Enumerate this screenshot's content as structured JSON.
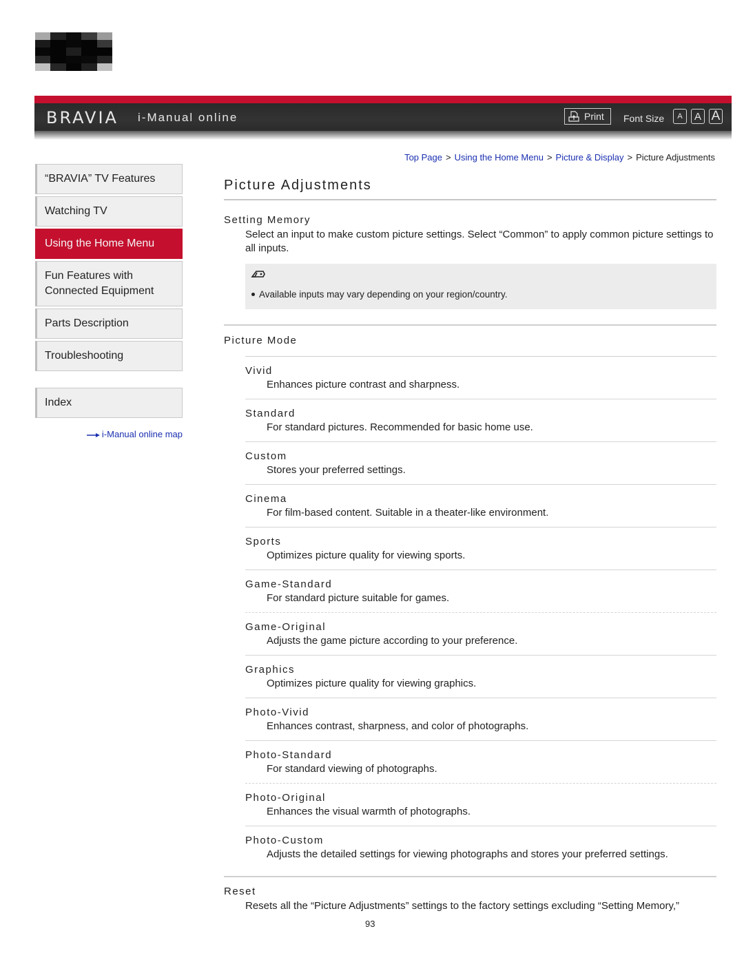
{
  "logo_pixels": [
    [
      "#a8a8a8",
      "#222222",
      "#0c0c0c",
      "#3c3c3c",
      "#9a9a9a"
    ],
    [
      "#1a1a1a",
      "#050505",
      "#080808",
      "#050505",
      "#383838"
    ],
    [
      "#080808",
      "#050505",
      "#1e1e1e",
      "#050505",
      "#050505"
    ],
    [
      "#2a2a2a",
      "#050505",
      "#080808",
      "#0a0a0a",
      "#262626"
    ],
    [
      "#c0c0c0",
      "#262626",
      "#050505",
      "#202020",
      "#c0c0c0"
    ]
  ],
  "header": {
    "brand": "BRAVIA",
    "subtitle": "i-Manual online",
    "print_label": "Print",
    "font_size_label": "Font Size",
    "font_size_options": [
      "A",
      "A",
      "A"
    ],
    "accent_color": "#c4102e"
  },
  "breadcrumb": {
    "items": [
      "Top Page",
      "Using the Home Menu",
      "Picture & Display"
    ],
    "current": "Picture Adjustments",
    "separator": ">"
  },
  "sidebar": {
    "items": [
      {
        "label": "“BRAVIA” TV Features",
        "active": false
      },
      {
        "label": "Watching TV",
        "active": false
      },
      {
        "label": "Using the Home Menu",
        "active": true
      },
      {
        "label": "Fun Features with Connected Equipment",
        "active": false
      },
      {
        "label": "Parts Description",
        "active": false
      },
      {
        "label": "Troubleshooting",
        "active": false
      }
    ],
    "index_label": "Index",
    "map_link": "i-Manual online map"
  },
  "main": {
    "title": "Picture Adjustments",
    "setting_memory": {
      "title": "Setting Memory",
      "body": "Select an input to make custom picture settings. Select “Common” to apply common picture settings to all inputs.",
      "note_icon": "note-pencil-icon",
      "note": "Available inputs may vary depending on your region/country."
    },
    "picture_mode": {
      "title": "Picture Mode",
      "modes": [
        {
          "name": "Vivid",
          "desc": "Enhances picture contrast and sharpness."
        },
        {
          "name": "Standard",
          "desc": "For standard pictures. Recommended for basic home use."
        },
        {
          "name": "Custom",
          "desc": "Stores your preferred settings."
        },
        {
          "name": "Cinema",
          "desc": "For film-based content. Suitable in a theater-like environment."
        },
        {
          "name": "Sports",
          "desc": "Optimizes picture quality for viewing sports."
        },
        {
          "name": "Game-Standard",
          "desc": "For standard picture suitable for games."
        },
        {
          "name": "Game-Original",
          "desc": "Adjusts the game picture according to your preference."
        },
        {
          "name": "Graphics",
          "desc": "Optimizes picture quality for viewing graphics."
        },
        {
          "name": "Photo-Vivid",
          "desc": "Enhances contrast, sharpness, and color of photographs."
        },
        {
          "name": "Photo-Standard",
          "desc": "For standard viewing of photographs."
        },
        {
          "name": "Photo-Original",
          "desc": "Enhances the visual warmth of photographs."
        },
        {
          "name": "Photo-Custom",
          "desc": "Adjusts the detailed settings for viewing photographs and stores your preferred settings."
        }
      ]
    },
    "reset": {
      "title": "Reset",
      "body": "Resets all the “Picture Adjustments” settings to the factory settings excluding “Setting Memory,”"
    }
  },
  "page_number": "93"
}
